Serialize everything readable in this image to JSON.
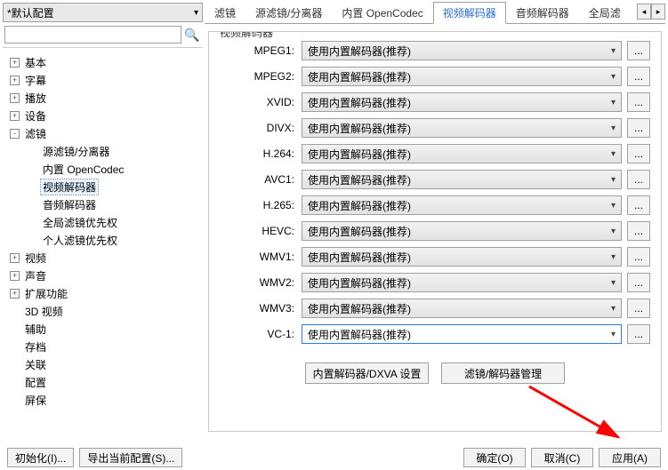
{
  "config_select": {
    "selected": "*默认配置"
  },
  "search": {
    "placeholder": ""
  },
  "tree": [
    {
      "label": "基本",
      "depth": 1,
      "toggle": "+"
    },
    {
      "label": "字幕",
      "depth": 1,
      "toggle": "+"
    },
    {
      "label": "播放",
      "depth": 1,
      "toggle": "+"
    },
    {
      "label": "设备",
      "depth": 1,
      "toggle": "+"
    },
    {
      "label": "滤镜",
      "depth": 1,
      "toggle": "-"
    },
    {
      "label": "源滤镜/分离器",
      "depth": 2,
      "toggle": " "
    },
    {
      "label": "内置 OpenCodec",
      "depth": 2,
      "toggle": " "
    },
    {
      "label": "视频解码器",
      "depth": 2,
      "toggle": " ",
      "selected": true
    },
    {
      "label": "音频解码器",
      "depth": 2,
      "toggle": " "
    },
    {
      "label": "全局滤镜优先权",
      "depth": 2,
      "toggle": " "
    },
    {
      "label": "个人滤镜优先权",
      "depth": 2,
      "toggle": " "
    },
    {
      "label": "视频",
      "depth": 1,
      "toggle": "+"
    },
    {
      "label": "声音",
      "depth": 1,
      "toggle": "+"
    },
    {
      "label": "扩展功能",
      "depth": 1,
      "toggle": "+"
    },
    {
      "label": "3D 视频",
      "depth": 1,
      "toggle": " "
    },
    {
      "label": "辅助",
      "depth": 1,
      "toggle": " "
    },
    {
      "label": "存档",
      "depth": 1,
      "toggle": " "
    },
    {
      "label": "关联",
      "depth": 1,
      "toggle": " "
    },
    {
      "label": "配置",
      "depth": 1,
      "toggle": " "
    },
    {
      "label": "屏保",
      "depth": 1,
      "toggle": " "
    }
  ],
  "tabs": {
    "items": [
      "滤镜",
      "源滤镜/分离器",
      "内置 OpenCodec",
      "视频解码器",
      "音频解码器",
      "全局滤"
    ],
    "active_index": 3
  },
  "group_title": "视频解码器",
  "codecs": [
    {
      "name": "MPEG1:",
      "value": "使用内置解码器(推荐)"
    },
    {
      "name": "MPEG2:",
      "value": "使用内置解码器(推荐)"
    },
    {
      "name": "XVID:",
      "value": "使用内置解码器(推荐)"
    },
    {
      "name": "DIVX:",
      "value": "使用内置解码器(推荐)"
    },
    {
      "name": "H.264:",
      "value": "使用内置解码器(推荐)"
    },
    {
      "name": "AVC1:",
      "value": "使用内置解码器(推荐)"
    },
    {
      "name": "H.265:",
      "value": "使用内置解码器(推荐)"
    },
    {
      "name": "HEVC:",
      "value": "使用内置解码器(推荐)"
    },
    {
      "name": "WMV1:",
      "value": "使用内置解码器(推荐)"
    },
    {
      "name": "WMV2:",
      "value": "使用内置解码器(推荐)"
    },
    {
      "name": "WMV3:",
      "value": "使用内置解码器(推荐)"
    },
    {
      "name": "VC-1:",
      "value": "使用内置解码器(推荐)",
      "selected": true
    }
  ],
  "more_label": "...",
  "bottom_buttons": {
    "dxva": "内置解码器/DXVA 设置",
    "manage": "滤镜/解码器管理"
  },
  "footer": {
    "init": "初始化(I)...",
    "export": "导出当前配置(S)...",
    "ok": "确定(O)",
    "cancel": "取消(C)",
    "apply": "应用(A)"
  }
}
